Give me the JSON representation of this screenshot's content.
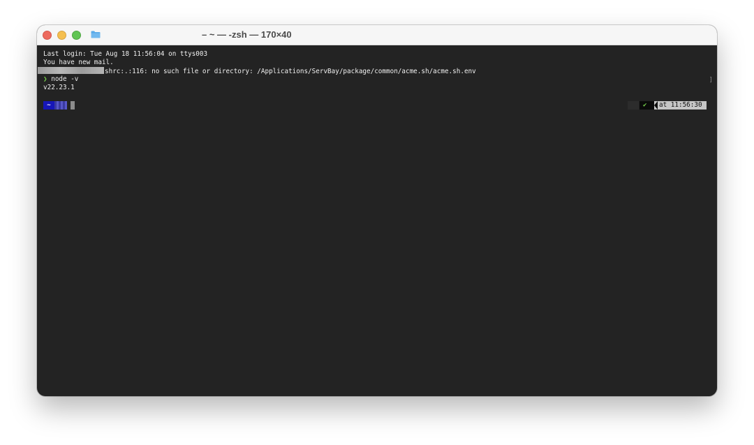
{
  "window": {
    "title": "– ~ — -zsh — 170×40"
  },
  "icons": {
    "close": "close-icon",
    "minimize": "minimize-icon",
    "maximize": "maximize-icon",
    "folder": "folder-icon"
  },
  "colors": {
    "terminal_bg": "#232323",
    "terminal_text": "#f0f0f0",
    "prompt_green": "#76d04b",
    "home_segment": "#1616b8",
    "time_segment": "#c6c6c6"
  },
  "terminal": {
    "lines": [
      "Last login: Tue Aug 18 11:56:04 on ttys003",
      "You have new mail.",
      "shrc:.:116: no such file or directory: /Applications/ServBay/package/common/acme.sh/acme.sh.env",
      "node -v",
      "v22.23.1"
    ],
    "prompt_glyph": "❯",
    "right_bracket": "]",
    "prompt": {
      "home_symbol": "~",
      "status_symbol": "✔",
      "time_text": "at 11:56:30"
    }
  }
}
